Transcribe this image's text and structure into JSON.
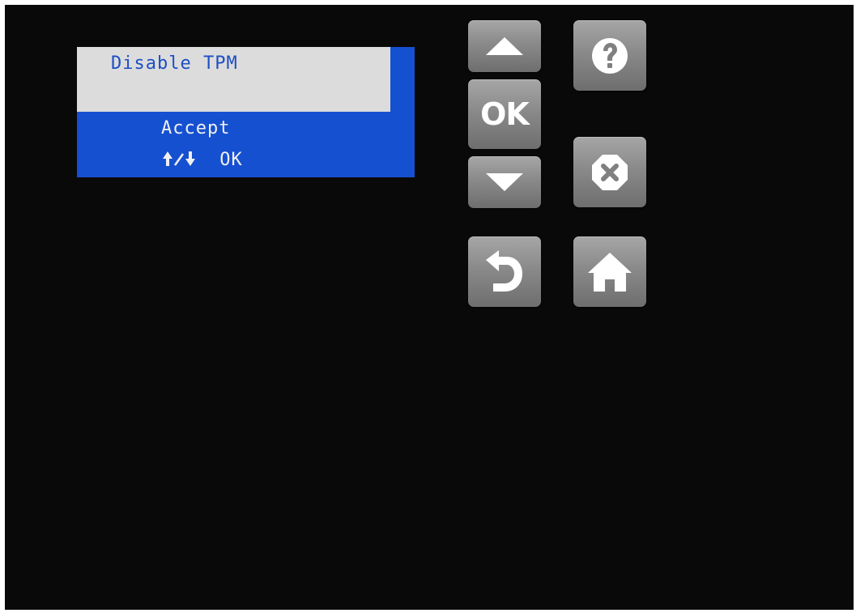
{
  "lcd": {
    "title": "Disable TPM",
    "option": "Accept",
    "hint_ok": "OK",
    "colors": {
      "panel": "#1550d0",
      "highlight": "#dcdcdc",
      "text_on_highlight": "#1d4fc4",
      "text_on_panel": "#f0f0f0"
    }
  },
  "keypad": {
    "up": {
      "icon": "triangle-up-icon"
    },
    "ok": {
      "label": "OK"
    },
    "down": {
      "icon": "triangle-down-icon"
    },
    "help": {
      "icon": "question-mark-icon"
    },
    "cancel": {
      "icon": "x-octagon-icon"
    },
    "back": {
      "icon": "return-arrow-icon"
    },
    "home": {
      "icon": "house-icon"
    }
  },
  "colors": {
    "background": "#0a0909",
    "button": "#8a8a8a"
  }
}
